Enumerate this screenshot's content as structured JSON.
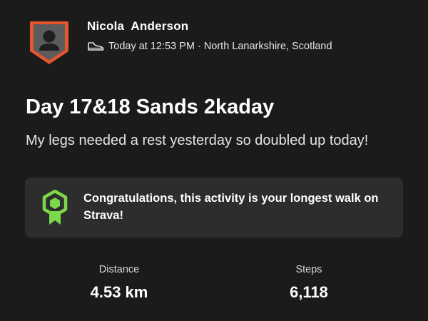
{
  "activity": {
    "athlete_name": "Nicola  Anderson",
    "activity_type_icon": "shoe-icon",
    "timestamp": "Today at 12:53 PM",
    "separator": " · ",
    "location": "North Lanarkshire, Scotland",
    "title": "Day 17&18 Sands 2kaday",
    "description": "My legs needed a rest yesterday so doubled up today!"
  },
  "achievement": {
    "icon": "achievement-badge-icon",
    "text": "Congratulations, this activity is your longest walk on Strava!",
    "accent_color": "#7ad84a"
  },
  "stats": [
    {
      "label": "Distance",
      "value": "4.53 km"
    },
    {
      "label": "Steps",
      "value": "6,118"
    }
  ],
  "colors": {
    "background": "#1c1b1b",
    "card_background": "#2e2d2d",
    "avatar_border": "#e4572e",
    "avatar_fill": "#5a5a5a"
  }
}
